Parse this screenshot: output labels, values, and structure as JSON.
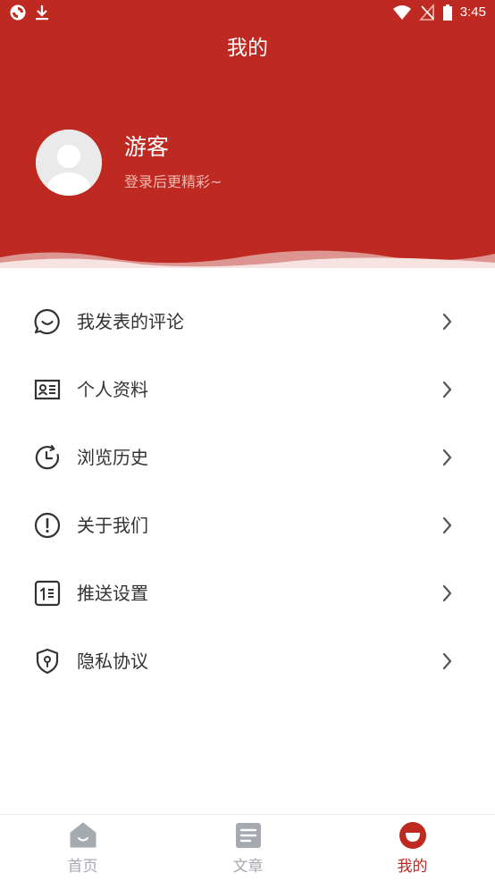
{
  "status_bar": {
    "time": "3:45",
    "left_icons": [
      "sync-icon",
      "download-icon"
    ],
    "right_icons": [
      "wifi-icon",
      "no-signal-icon",
      "battery-icon"
    ]
  },
  "header": {
    "title": "我的",
    "username": "游客",
    "login_hint": "登录后更精彩~",
    "background_color": "#BE2A21"
  },
  "menu": [
    {
      "label": "我发表的评论",
      "icon": "comment-icon"
    },
    {
      "label": "个人资料",
      "icon": "id-card-icon"
    },
    {
      "label": "浏览历史",
      "icon": "history-icon"
    },
    {
      "label": "关于我们",
      "icon": "info-icon"
    },
    {
      "label": "推送设置",
      "icon": "push-settings-icon"
    },
    {
      "label": "隐私协议",
      "icon": "privacy-shield-icon"
    }
  ],
  "tabbar": {
    "tabs": [
      {
        "label": "首页",
        "icon": "home-icon",
        "active": false
      },
      {
        "label": "文章",
        "icon": "article-icon",
        "active": false
      },
      {
        "label": "我的",
        "icon": "profile-icon",
        "active": true
      }
    ],
    "active_color": "#BE2A21",
    "inactive_color": "#A5A9B0"
  }
}
